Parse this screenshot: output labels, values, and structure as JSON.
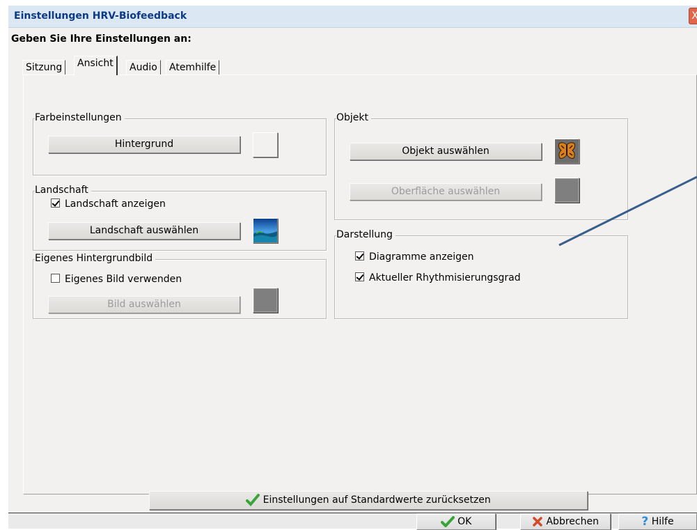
{
  "window": {
    "title": "Einstellungen HRV-Biofeedback",
    "close_glyph": "X"
  },
  "prompt": "Geben Sie Ihre Einstellungen an:",
  "tabs": [
    {
      "label": "Sitzung",
      "active": false
    },
    {
      "label": "Ansicht",
      "active": true
    },
    {
      "label": "Audio",
      "active": false
    },
    {
      "label": "Atemhilfe",
      "active": false
    }
  ],
  "farbeinstellungen": {
    "title": "Farbeinstellungen",
    "hintergrund_button": "Hintergrund"
  },
  "landschaft": {
    "title": "Landschaft",
    "show_label": "Landschaft anzeigen",
    "show_checked": true,
    "select_button": "Landschaft auswählen"
  },
  "eigenes_bild": {
    "title": "Eigenes Hintergrundbild",
    "use_label": "Eigenes Bild verwenden",
    "use_checked": false,
    "select_button": "Bild auswählen"
  },
  "objekt": {
    "title": "Objekt",
    "select_button": "Objekt auswählen",
    "surface_button": "Oberfläche auswählen"
  },
  "darstellung": {
    "title": "Darstellung",
    "diagramme_label": "Diagramme anzeigen",
    "diagramme_checked": true,
    "rhythmus_label": "Aktueller Rhythmisierungsgrad",
    "rhythmus_checked": true
  },
  "reset_button": "Einstellungen auf Standardwerte zurücksetzen",
  "footer": {
    "ok": "OK",
    "cancel": "Abbrechen",
    "help": "Hilfe"
  },
  "colors": {
    "title_text": "#0d3a86",
    "titlebar_bg": "#dce7f4",
    "dialog_bg": "#f2f1f0",
    "annotation_arrow": "#3a5e8c"
  }
}
